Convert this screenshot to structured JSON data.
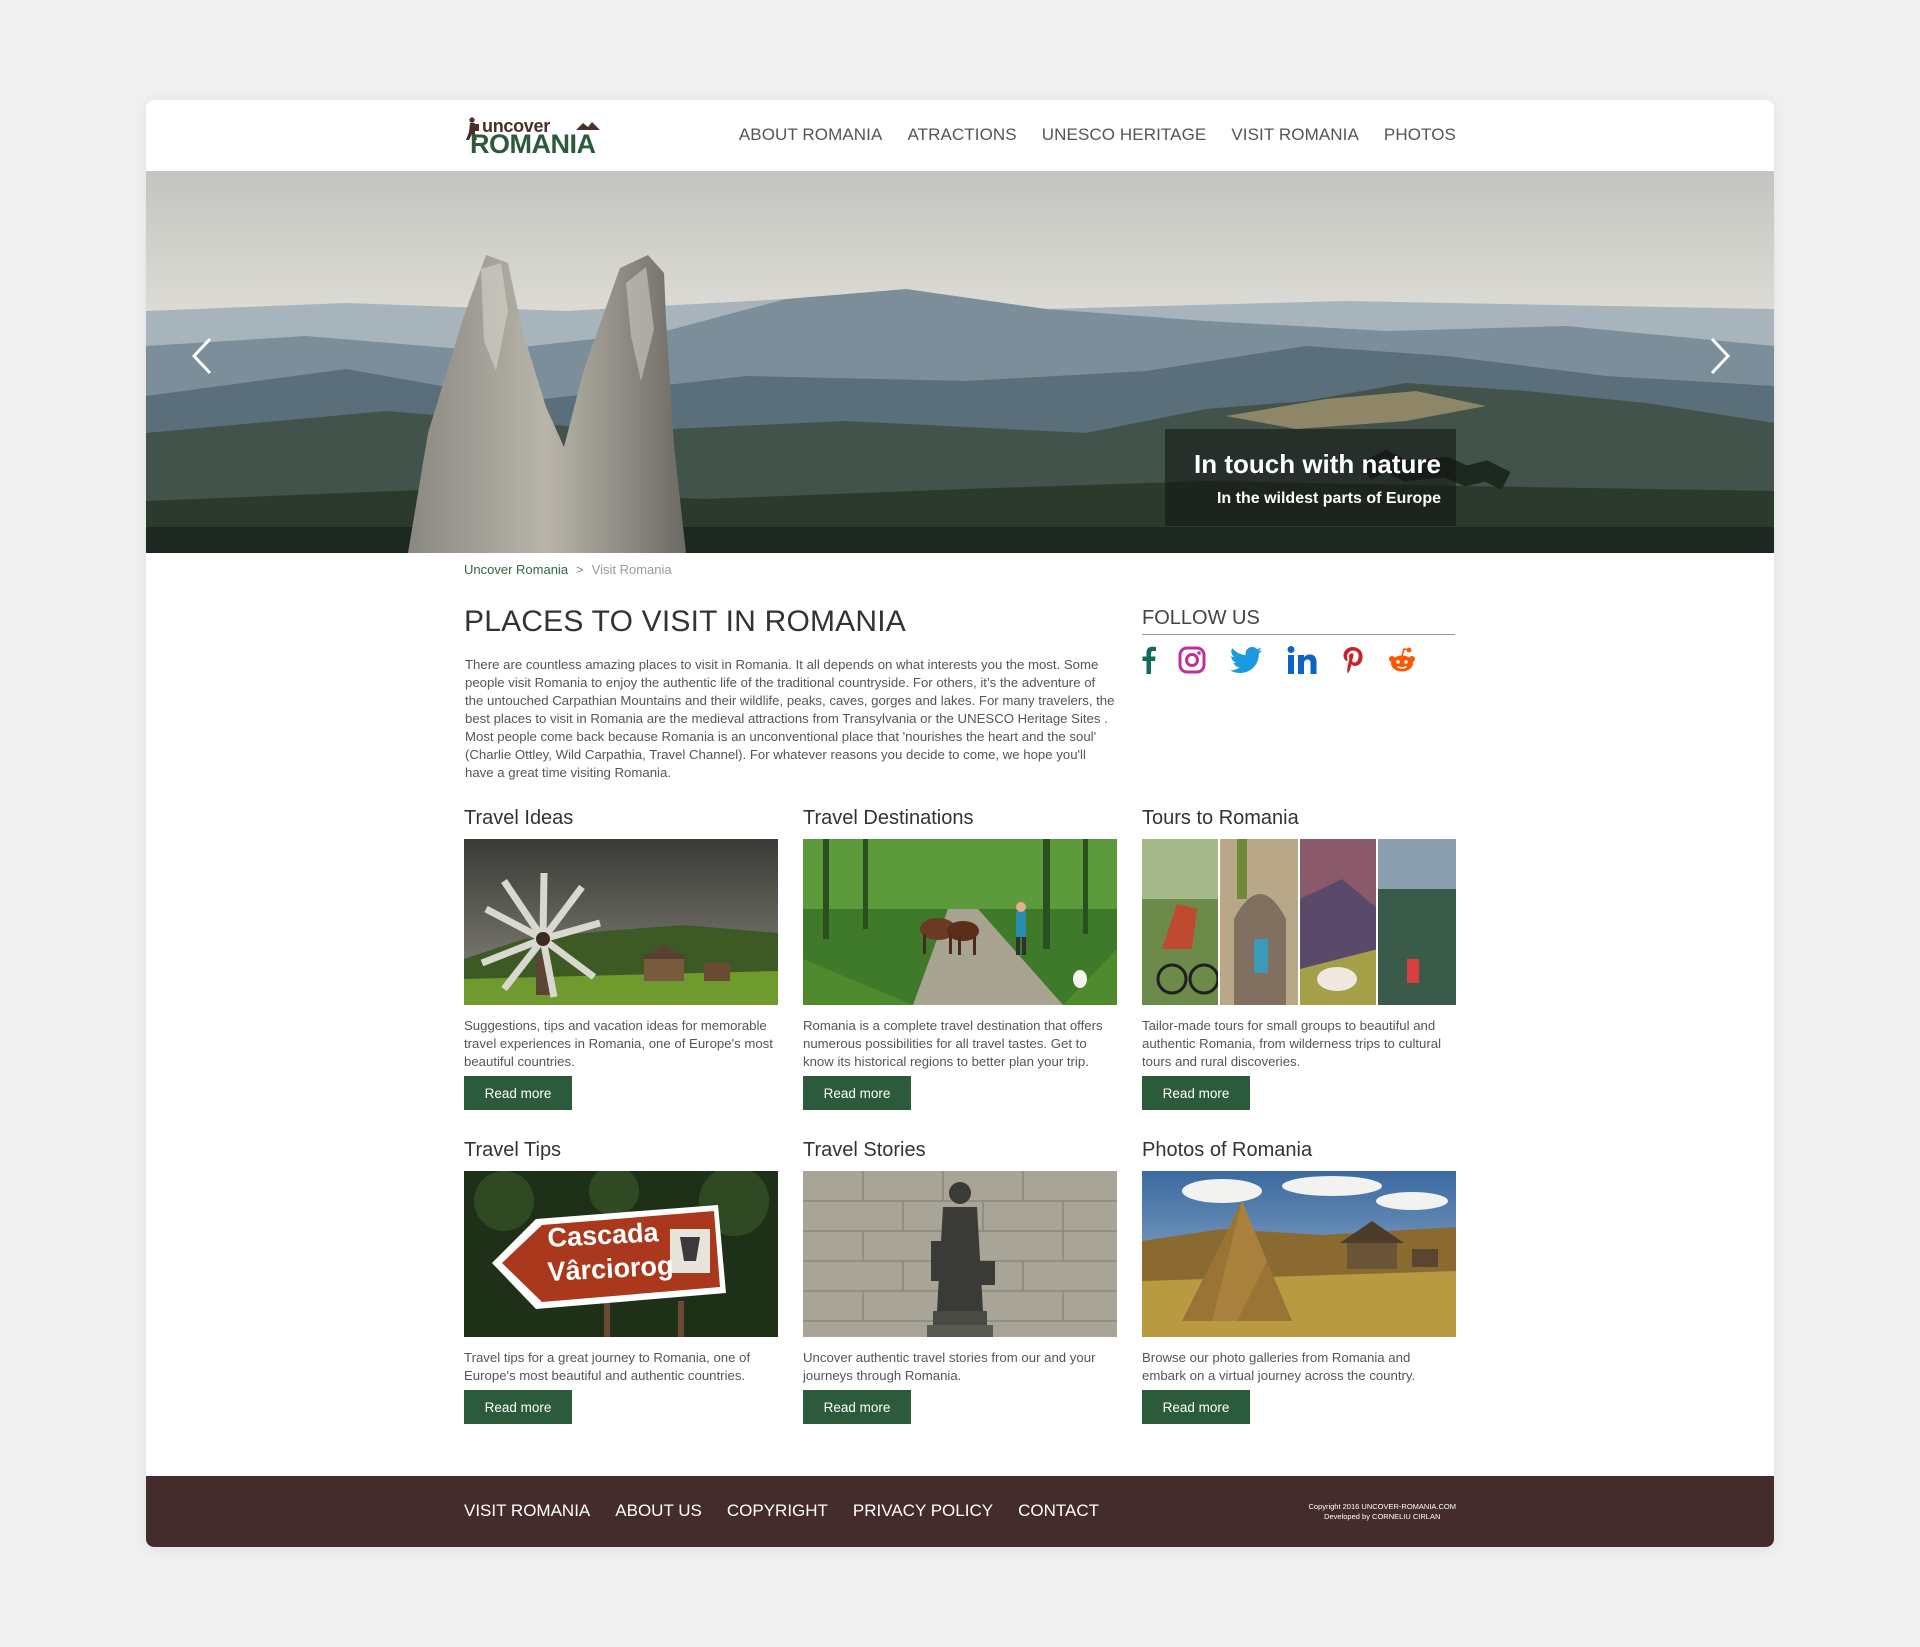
{
  "header": {
    "logo_top": "uncover",
    "logo_bottom": "ROMANIA",
    "nav": [
      "ABOUT ROMANIA",
      "ATRACTIONS",
      "UNESCO HERITAGE",
      "VISIT ROMANIA",
      "PHOTOS"
    ]
  },
  "hero": {
    "title": "In touch with nature",
    "subtitle": "In the wildest parts of Europe",
    "prev_icon": "chevron-left-icon",
    "next_icon": "chevron-right-icon"
  },
  "breadcrumb": {
    "home": "Uncover Romania",
    "separator": ">",
    "current": "Visit Romania"
  },
  "main": {
    "title": "PLACES TO VISIT IN ROMANIA",
    "intro": "There are countless amazing places to visit in Romania. It all depends on what interests you the most. Some people visit Romania to enjoy the authentic life of the traditional countryside. For others, it’s the adventure of the untouched Carpathian Mountains  and their wildlife, peaks, caves, gorges and lakes. For many travelers, the best places to visit in Romania are the medieval attractions from Transylvania  or the UNESCO Heritage Sites . Most people come back because Romania is an unconventional place that 'nourishes the heart and the soul' (Charlie Ottley, Wild Carpathia, Travel Channel). For whatever reasons you decide to come, we hope you'll have a great time visiting Romania."
  },
  "follow": {
    "title": "FOLLOW US",
    "icons": [
      "facebook-icon",
      "instagram-icon",
      "twitter-icon",
      "linkedin-icon",
      "pinterest-icon",
      "reddit-icon"
    ]
  },
  "sections": [
    {
      "title": "Travel Ideas",
      "text": "Suggestions, tips and vacation ideas for memorable travel experiences in Romania, one of Europe's most beautiful countries.",
      "button": "Read more"
    },
    {
      "title": "Travel Destinations",
      "text": "Romania is a complete travel destination that offers numerous possibilities for all travel tastes. Get to know its historical regions to better plan your trip.",
      "button": "Read more"
    },
    {
      "title": "Tours to Romania",
      "text": "Tailor-made tours for small groups to beautiful and authentic Romania, from wilderness trips to cultural tours and rural discoveries.",
      "button": "Read more"
    },
    {
      "title": "Travel Tips",
      "text": "Travel tips for a great journey to Romania, one of Europe's most beautiful and authentic countries.",
      "button": "Read more"
    },
    {
      "title": "Travel Stories",
      "text": "Uncover authentic travel stories from our and your journeys through Romania.",
      "button": "Read more"
    },
    {
      "title": "Photos of Romania",
      "text": "Browse our photo galleries from Romania and embark on a virtual journey across the country.",
      "button": "Read more"
    }
  ],
  "images": {
    "sign_line1": "Cascada",
    "sign_line2": "Vârciorog"
  },
  "footer": {
    "links": [
      "VISIT ROMANIA",
      "ABOUT US",
      "COPYRIGHT",
      "PRIVACY POLICY",
      "CONTACT"
    ],
    "copyright": "Copyright 2016 UNCOVER-ROMANIA.COM",
    "developer": "Developed by CORNELIU CIRLAN"
  },
  "colors": {
    "accent_green": "#2c5b3c",
    "footer_brown": "#452c2c",
    "background": "#f0f0f0"
  }
}
